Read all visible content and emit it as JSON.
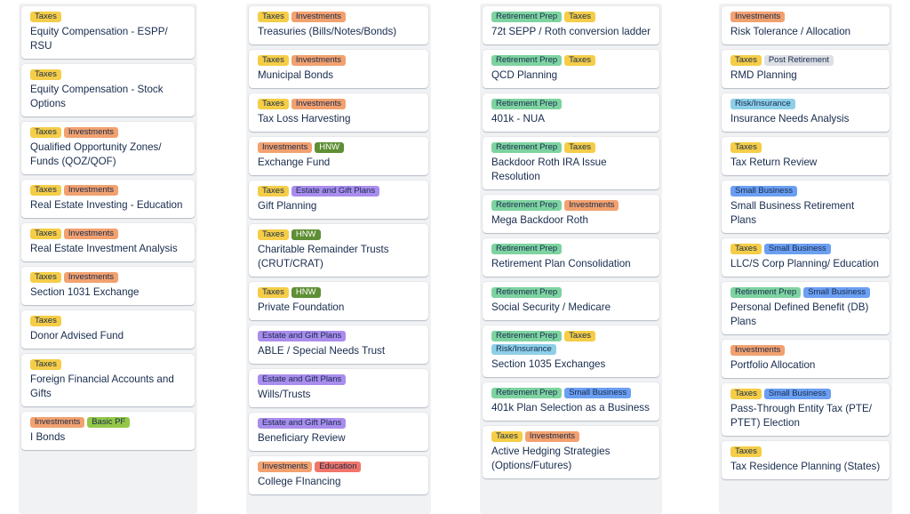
{
  "label_colors": {
    "Taxes": "#f5cd47",
    "Investments": "#f2a16f",
    "Retirement Prep": "#7ed3a0",
    "HNW": "#5f8f35",
    "Estate and Gift Plans": "#a98ded",
    "Education": "#f0756a",
    "Basic PF": "#94c748",
    "Small Business": "#6b9ff2",
    "Risk/Insurance": "#8ecfe8",
    "Post Retirement": "#dcdfe4"
  },
  "light_text_labels": [
    "HNW"
  ],
  "columns": [
    {
      "cards": [
        {
          "labels": [
            "Taxes"
          ],
          "title": "Equity Compensation - ESPP/ RSU"
        },
        {
          "labels": [
            "Taxes"
          ],
          "title": "Equity Compensation - Stock Options"
        },
        {
          "labels": [
            "Taxes",
            "Investments"
          ],
          "title": "Qualified Opportunity Zones/ Funds (QOZ/QOF)"
        },
        {
          "labels": [
            "Taxes",
            "Investments"
          ],
          "title": "Real Estate Investing - Education"
        },
        {
          "labels": [
            "Taxes",
            "Investments"
          ],
          "title": "Real Estate Investment Analysis"
        },
        {
          "labels": [
            "Taxes",
            "Investments"
          ],
          "title": "Section 1031 Exchange"
        },
        {
          "labels": [
            "Taxes"
          ],
          "title": "Donor Advised Fund"
        },
        {
          "labels": [
            "Taxes"
          ],
          "title": "Foreign Financial Accounts and Gifts"
        },
        {
          "labels": [
            "Investments",
            "Basic PF"
          ],
          "title": "I Bonds"
        }
      ]
    },
    {
      "cards": [
        {
          "labels": [
            "Taxes",
            "Investments"
          ],
          "title": "Treasuries (Bills/Notes/Bonds)"
        },
        {
          "labels": [
            "Taxes",
            "Investments"
          ],
          "title": "Municipal Bonds"
        },
        {
          "labels": [
            "Taxes",
            "Investments"
          ],
          "title": "Tax Loss Harvesting"
        },
        {
          "labels": [
            "Investments",
            "HNW"
          ],
          "title": "Exchange Fund"
        },
        {
          "labels": [
            "Taxes",
            "Estate and Gift Plans"
          ],
          "title": "Gift Planning"
        },
        {
          "labels": [
            "Taxes",
            "HNW"
          ],
          "title": "Charitable Remainder Trusts (CRUT/CRAT)"
        },
        {
          "labels": [
            "Taxes",
            "HNW"
          ],
          "title": "Private Foundation"
        },
        {
          "labels": [
            "Estate and Gift Plans"
          ],
          "title": "ABLE / Special Needs Trust"
        },
        {
          "labels": [
            "Estate and Gift Plans"
          ],
          "title": "Wills/Trusts"
        },
        {
          "labels": [
            "Estate and Gift Plans"
          ],
          "title": "Beneficiary Review"
        },
        {
          "labels": [
            "Investments",
            "Education"
          ],
          "title": "College FInancing"
        }
      ]
    },
    {
      "cards": [
        {
          "labels": [
            "Retirement Prep",
            "Taxes"
          ],
          "title": "72t SEPP / Roth conversion ladder"
        },
        {
          "labels": [
            "Retirement Prep",
            "Taxes"
          ],
          "title": "QCD Planning"
        },
        {
          "labels": [
            "Retirement Prep"
          ],
          "title": "401k - NUA"
        },
        {
          "labels": [
            "Retirement Prep",
            "Taxes"
          ],
          "title": "Backdoor Roth IRA Issue Resolution"
        },
        {
          "labels": [
            "Retirement Prep",
            "Investments"
          ],
          "title": "Mega Backdoor Roth"
        },
        {
          "labels": [
            "Retirement Prep"
          ],
          "title": "Retirement Plan Consolidation"
        },
        {
          "labels": [
            "Retirement Prep"
          ],
          "title": "Social Security / Medicare"
        },
        {
          "labels": [
            "Retirement Prep",
            "Taxes",
            "Risk/Insurance"
          ],
          "title": "Section 1035 Exchanges"
        },
        {
          "labels": [
            "Retirement Prep",
            "Small Business"
          ],
          "title": "401k Plan Selection as a Business"
        },
        {
          "labels": [
            "Taxes",
            "Investments"
          ],
          "title": "Active Hedging Strategies (Options/Futures)"
        }
      ]
    },
    {
      "cards": [
        {
          "labels": [
            "Investments"
          ],
          "title": "Risk Tolerance / Allocation"
        },
        {
          "labels": [
            "Taxes",
            "Post Retirement"
          ],
          "title": "RMD Planning"
        },
        {
          "labels": [
            "Risk/Insurance"
          ],
          "title": "Insurance Needs Analysis"
        },
        {
          "labels": [
            "Taxes"
          ],
          "title": "Tax Return Review"
        },
        {
          "labels": [
            "Small Business"
          ],
          "title": "Small Business Retirement Plans"
        },
        {
          "labels": [
            "Taxes",
            "Small Business"
          ],
          "title": "LLC/S Corp Planning/ Education"
        },
        {
          "labels": [
            "Retirement Prep",
            "Small Business"
          ],
          "title": "Personal Defined Benefit (DB) Plans"
        },
        {
          "labels": [
            "Investments"
          ],
          "title": "Portfolio Allocation"
        },
        {
          "labels": [
            "Taxes",
            "Small Business"
          ],
          "title": "Pass-Through Entity Tax (PTE/ PTET) Election"
        },
        {
          "labels": [
            "Taxes"
          ],
          "title": "Tax Residence Planning (States)"
        }
      ]
    }
  ]
}
